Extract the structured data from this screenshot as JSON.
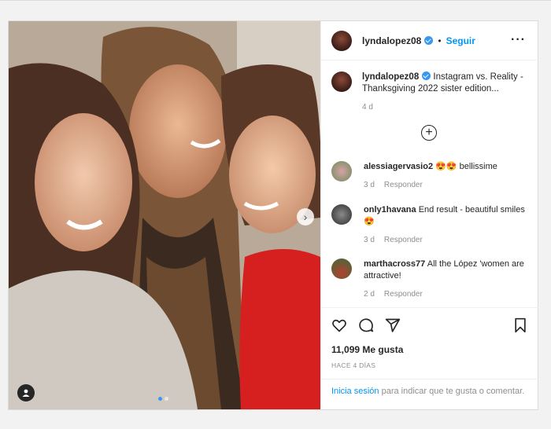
{
  "post": {
    "username": "lyndalopez08",
    "separator": "•",
    "follow_label": "Seguir",
    "more_icon": "more-horizontal-icon",
    "caption": {
      "text": "Instagram vs. Reality - Thanksgiving 2022 sister edition...",
      "time": "4 d"
    },
    "load_more_icon": "plus-circle-icon",
    "comments": [
      {
        "user": "alessiagervasio2",
        "text": "😍😍 bellissime",
        "time": "3 d",
        "reply": "Responder"
      },
      {
        "user": "only1havana",
        "text": "End result - beautiful smiles 😍",
        "time": "3 d",
        "reply": "Responder"
      },
      {
        "user": "marthacross77",
        "text": "All the López 'women are attractive!",
        "time": "2 d",
        "reply": "Responder"
      }
    ],
    "likes": "11,099 Me gusta",
    "ago": "HACE 4 DÍAS",
    "login_link": "Inicia sesión",
    "login_rest": " para indicar que te gusta o comentar."
  },
  "colors": {
    "link": "#0095f6",
    "verified": "#3897f0",
    "muted": "#8e8e8e"
  }
}
